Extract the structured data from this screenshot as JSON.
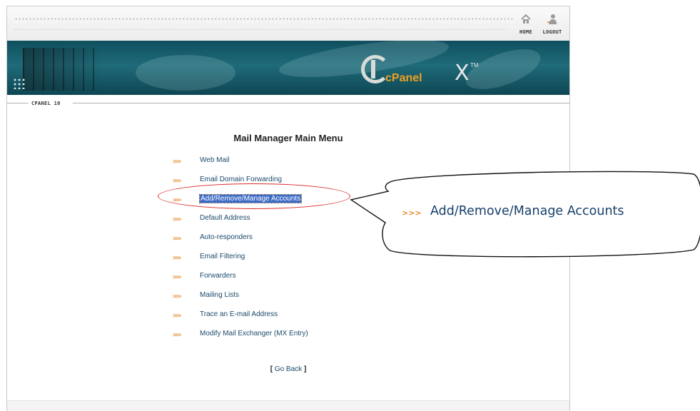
{
  "header": {
    "home_label": "HOME",
    "logout_label": "LOGOUT",
    "home_icon": "house-icon",
    "logout_icon": "user-icon"
  },
  "banner": {
    "logo_word": "cPanel",
    "logo_x": "X",
    "logo_tm": "TM"
  },
  "breadcrumb": {
    "label": "CPANEL 10"
  },
  "main": {
    "title": "Mail Manager Main Menu",
    "arrow_glyph": ">>>",
    "items": [
      {
        "label": "Web Mail"
      },
      {
        "label": "Email Domain Forwarding"
      },
      {
        "label": "Add/Remove/Manage Accounts",
        "selected": true
      },
      {
        "label": "Default Address"
      },
      {
        "label": "Auto-responders"
      },
      {
        "label": "Email Filtering"
      },
      {
        "label": "Forwarders"
      },
      {
        "label": "Mailing Lists"
      },
      {
        "label": "Trace an E-mail Address"
      },
      {
        "label": "Modify Mail Exchanger (MX Entry)"
      }
    ],
    "go_back": {
      "open": "[",
      "label": "Go Back",
      "close": "]"
    }
  },
  "callout": {
    "arrow_glyph": ">>>",
    "text": "Add/Remove/Manage Accounts"
  },
  "colors": {
    "accent_orange": "#e58a2c",
    "link_blue": "#1b4a6b",
    "highlight_red": "#d92b2b",
    "selection_blue": "#3d6bc4",
    "banner_teal": "#1f6b79"
  }
}
